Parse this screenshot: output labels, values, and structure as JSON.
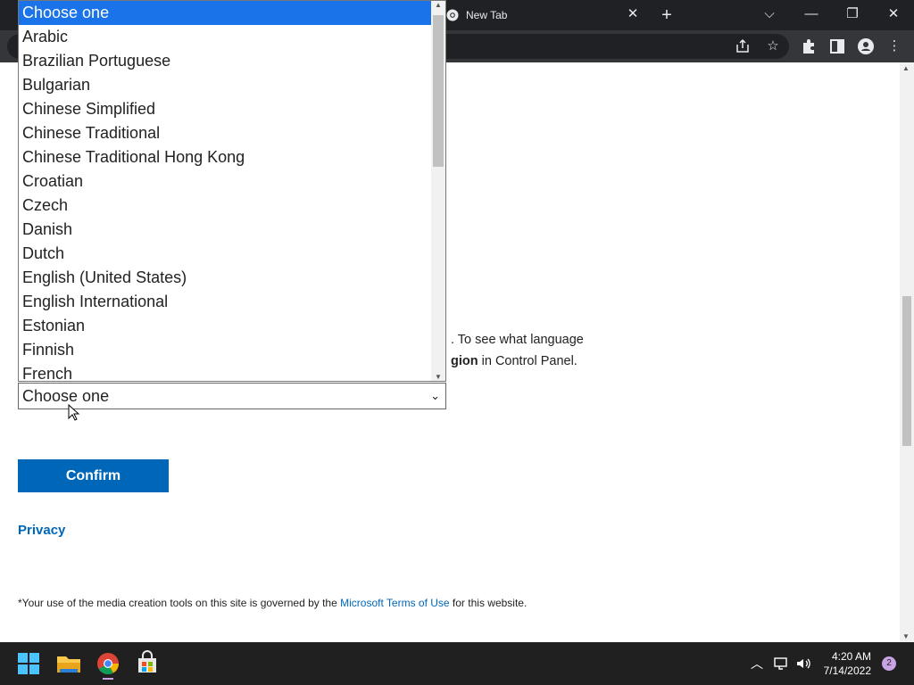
{
  "browser": {
    "tab_title": "New Tab",
    "tab_close": "✕",
    "new_tab": "+",
    "window_controls": {
      "dropdown": "⌵",
      "minimize": "—",
      "restore": "❐",
      "close": "✕"
    }
  },
  "page": {
    "info_line1_tail": ". To see what language",
    "info_line2_bold": "gion",
    "info_line2_rest": " in Control Panel.",
    "select_value": "Choose one",
    "confirm_label": "Confirm",
    "privacy_label": "Privacy",
    "footer_prefix": "*Your use of the media creation tools on this site is governed by the ",
    "footer_link": "Microsoft Terms of Use",
    "footer_suffix": " for this website."
  },
  "dropdown": {
    "options": [
      "Choose one",
      "Arabic",
      "Brazilian Portuguese",
      "Bulgarian",
      "Chinese Simplified",
      "Chinese Traditional",
      "Chinese Traditional Hong Kong",
      "Croatian",
      "Czech",
      "Danish",
      "Dutch",
      "English (United States)",
      "English International",
      "Estonian",
      "Finnish",
      "French"
    ],
    "selected_index": 0
  },
  "taskbar": {
    "time": "4:20 AM",
    "date": "7/14/2022",
    "notification_count": "2"
  },
  "colors": {
    "accent": "#0067b8",
    "selection": "#1a73e8",
    "taskbar": "#202020",
    "browser_frame": "#202124"
  }
}
